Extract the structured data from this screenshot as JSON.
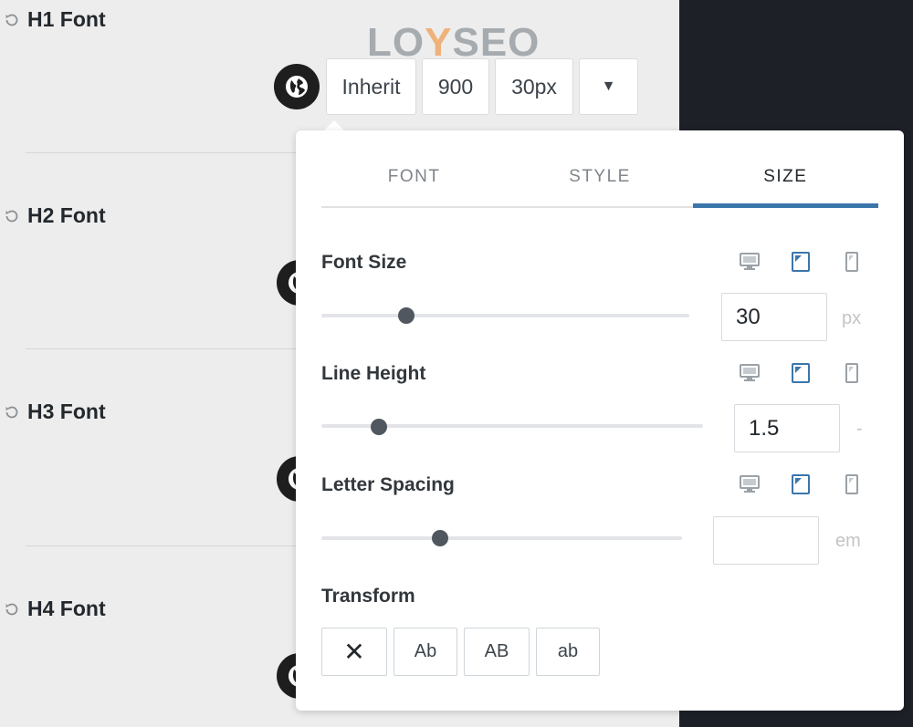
{
  "brand": {
    "logo_text_prefix": "LO",
    "logo_text_y": "Y",
    "logo_text_suffix": "SEO"
  },
  "font_rows": [
    {
      "label": "H1 Font"
    },
    {
      "label": "H2 Font"
    },
    {
      "label": "H3 Font"
    },
    {
      "label": "H4 Font"
    }
  ],
  "toolbar": {
    "family": "Inherit",
    "weight": "900",
    "size": "30px",
    "dropdown_glyph": "▼"
  },
  "popover": {
    "tabs": [
      {
        "label": "FONT",
        "active": false
      },
      {
        "label": "STYLE",
        "active": false
      },
      {
        "label": "SIZE",
        "active": true
      }
    ],
    "font_size": {
      "label": "Font Size",
      "value": "30",
      "unit": "px",
      "slider_fraction": 0.23
    },
    "line_height": {
      "label": "Line Height",
      "value": "1.5",
      "unit": "-",
      "slider_fraction": 0.15
    },
    "letter_spacing": {
      "label": "Letter Spacing",
      "value": "",
      "unit": "em",
      "slider_fraction": 0.33
    },
    "transform": {
      "label": "Transform",
      "options": [
        {
          "label": "✕",
          "name": "none"
        },
        {
          "label": "Ab",
          "name": "capitalize"
        },
        {
          "label": "AB",
          "name": "uppercase"
        },
        {
          "label": "ab",
          "name": "lowercase"
        }
      ]
    },
    "devices": [
      "desktop-icon",
      "tablet-icon",
      "mobile-icon"
    ],
    "active_device": "tablet-icon"
  },
  "colors": {
    "accent": "#3b76ab",
    "dark_panel": "#1d2027"
  }
}
